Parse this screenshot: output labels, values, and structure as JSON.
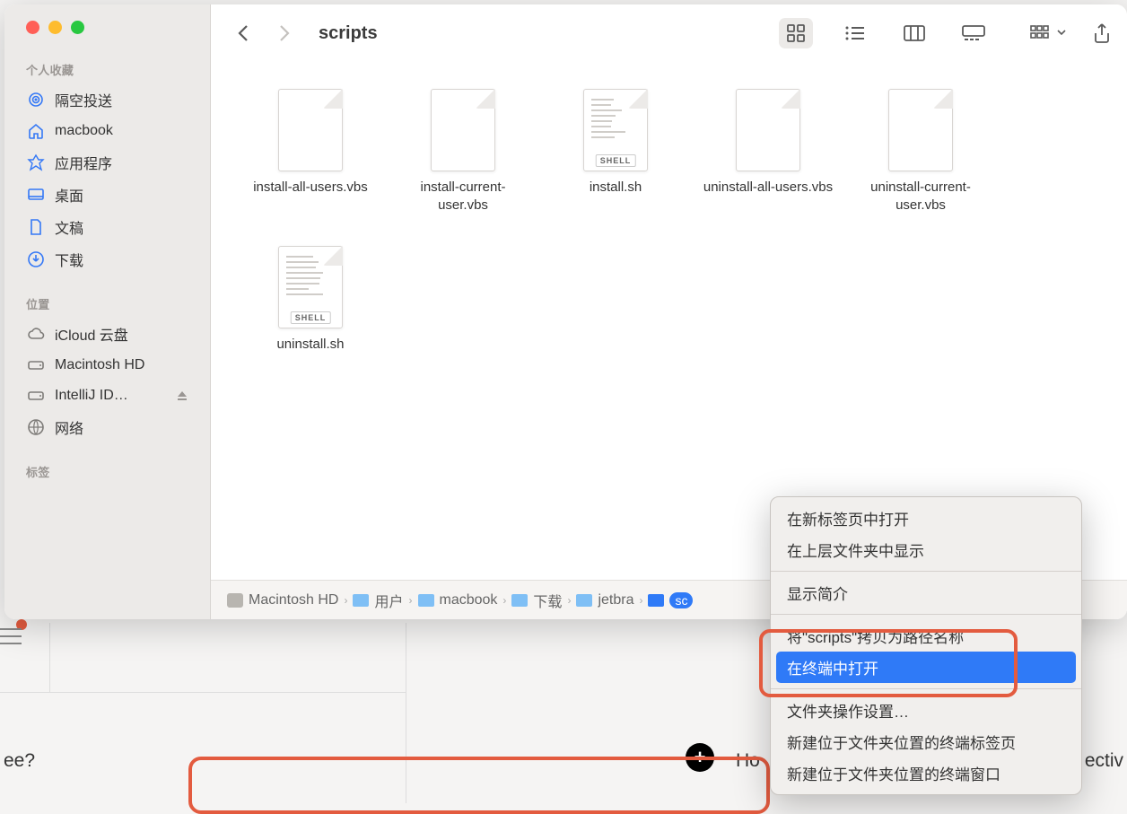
{
  "window": {
    "title": "scripts"
  },
  "sidebar": {
    "favorites_header": "个人收藏",
    "locations_header": "位置",
    "tags_header": "标签",
    "items": [
      {
        "label": "隔空投送"
      },
      {
        "label": "macbook"
      },
      {
        "label": "应用程序"
      },
      {
        "label": "桌面"
      },
      {
        "label": "文稿"
      },
      {
        "label": "下载"
      }
    ],
    "locations": [
      {
        "label": "iCloud 云盘"
      },
      {
        "label": "Macintosh HD"
      },
      {
        "label": "IntelliJ ID…"
      },
      {
        "label": "网络"
      }
    ]
  },
  "files": [
    {
      "name": "install-all-users.vbs",
      "type": "plain"
    },
    {
      "name": "install-current-user.vbs",
      "type": "plain"
    },
    {
      "name": "install.sh",
      "type": "shell",
      "badge": "SHELL"
    },
    {
      "name": "uninstall-all-users.vbs",
      "type": "plain"
    },
    {
      "name": "uninstall-current-user.vbs",
      "type": "plain"
    },
    {
      "name": "uninstall.sh",
      "type": "shell",
      "badge": "SHELL"
    }
  ],
  "pathbar": [
    {
      "label": "Macintosh HD",
      "kind": "disk"
    },
    {
      "label": "用户",
      "kind": "folder"
    },
    {
      "label": "macbook",
      "kind": "folder"
    },
    {
      "label": "下载",
      "kind": "folder"
    },
    {
      "label": "jetbra",
      "kind": "folder"
    },
    {
      "label": "sc",
      "kind": "selected"
    }
  ],
  "context_menu": {
    "items": [
      {
        "label": "在新标签页中打开",
        "type": "item"
      },
      {
        "label": "在上层文件夹中显示",
        "type": "item"
      },
      {
        "type": "sep"
      },
      {
        "label": "显示简介",
        "type": "item"
      },
      {
        "type": "sep"
      },
      {
        "label": "将\"scripts\"拷贝为路径名称",
        "type": "item"
      },
      {
        "label": "在终端中打开",
        "type": "item",
        "highlighted": true
      },
      {
        "type": "sep"
      },
      {
        "label": "文件夹操作设置…",
        "type": "item"
      },
      {
        "label": "新建位于文件夹位置的终端标签页",
        "type": "item"
      },
      {
        "label": "新建位于文件夹位置的终端窗口",
        "type": "item"
      }
    ]
  },
  "background": {
    "left_text": "ee?",
    "hov_text": "Ho",
    "right_text": "ectiv"
  }
}
